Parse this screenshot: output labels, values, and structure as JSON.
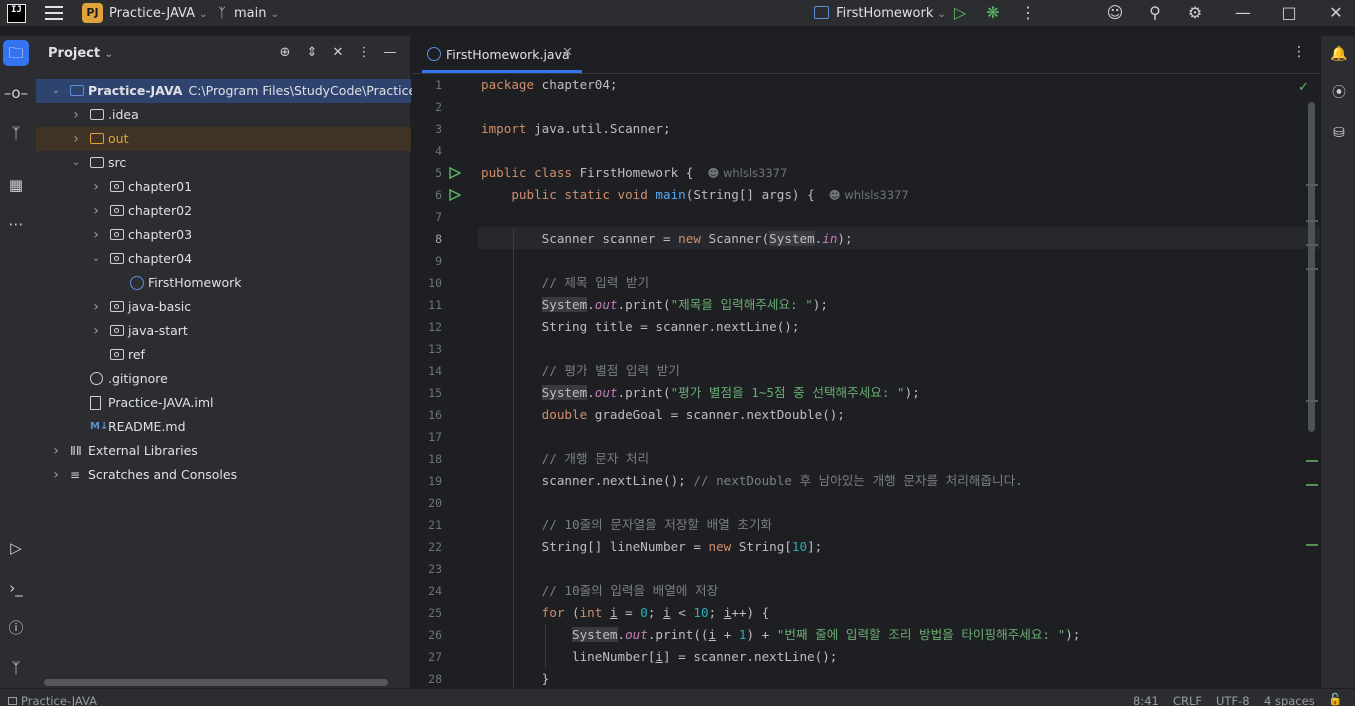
{
  "titlebar": {
    "logo_text": "IJ",
    "project_badge": "PJ",
    "project_name": "Practice-JAVA",
    "branch": "main",
    "run_config": "FirstHomework"
  },
  "project_panel": {
    "title": "Project",
    "tree": [
      {
        "label": "Practice-JAVA",
        "path": "C:\\Program Files\\StudyCode\\Practice-JAV",
        "icon": "folder-icon",
        "depth": 0,
        "expanded": true,
        "selected": true
      },
      {
        "label": ".idea",
        "icon": "folder-icon",
        "depth": 1,
        "expanded": false
      },
      {
        "label": "out",
        "icon": "folder-icon",
        "depth": 1,
        "expanded": false,
        "excluded": true
      },
      {
        "label": "src",
        "icon": "folder-icon",
        "depth": 1,
        "expanded": true
      },
      {
        "label": "chapter01",
        "icon": "package-icon",
        "depth": 2,
        "expanded": false
      },
      {
        "label": "chapter02",
        "icon": "package-icon",
        "depth": 2,
        "expanded": false
      },
      {
        "label": "chapter03",
        "icon": "package-icon",
        "depth": 2,
        "expanded": false
      },
      {
        "label": "chapter04",
        "icon": "package-icon",
        "depth": 2,
        "expanded": true
      },
      {
        "label": "FirstHomework",
        "icon": "class-icon",
        "depth": 3
      },
      {
        "label": "java-basic",
        "icon": "package-icon",
        "depth": 2,
        "expanded": false
      },
      {
        "label": "java-start",
        "icon": "package-icon",
        "depth": 2,
        "expanded": false
      },
      {
        "label": "ref",
        "icon": "package-icon",
        "depth": 2
      },
      {
        "label": ".gitignore",
        "icon": "ignore-icon",
        "depth": 1
      },
      {
        "label": "Practice-JAVA.iml",
        "icon": "file-icon",
        "depth": 1
      },
      {
        "label": "README.md",
        "icon": "markdown-icon",
        "depth": 1
      },
      {
        "label": "External Libraries",
        "icon": "library-icon",
        "depth": 0,
        "expanded": false
      },
      {
        "label": "Scratches and Consoles",
        "icon": "scratch-icon",
        "depth": 0,
        "expanded": false
      }
    ]
  },
  "editor": {
    "tab_label": "FirstHomework.java",
    "author": "whlsls3377",
    "line_numbers": [
      "1",
      "2",
      "3",
      "4",
      "5",
      "6",
      "7",
      "8",
      "9",
      "10",
      "11",
      "12",
      "13",
      "14",
      "15",
      "16",
      "17",
      "18",
      "19",
      "20",
      "21",
      "22",
      "23",
      "24",
      "25",
      "26",
      "27",
      "28"
    ],
    "current_line": "8",
    "code": {
      "l1_kw": "package",
      "l1_rest": " chapter04;",
      "l3_kw": "import",
      "l3_rest": " java.util.Scanner;",
      "l5_kw": "public class",
      "l5_rest": " FirstHomework {",
      "l6_kw": "public static void",
      "l6_fn": "main",
      "l6_rest": "(String[] args) {",
      "l8_a": "Scanner scanner = ",
      "l8_kw": "new",
      "l8_b": " Scanner(",
      "l8_sys": "System",
      "l8_dot": ".",
      "l8_in": "in",
      "l8_c": ");",
      "l10_cm": "// 제목 입력 받기",
      "l11_sys": "System",
      "l11_dot": ".",
      "l11_out": "out",
      "l11_a": ".print(",
      "l11_str": "\"제목을 입력해주세요: \"",
      "l11_b": ");",
      "l12": "String title = scanner.nextLine();",
      "l14_cm": "// 평가 별점 입력 받기",
      "l15_sys": "System",
      "l15_dot": ".",
      "l15_out": "out",
      "l15_a": ".print(",
      "l15_str": "\"평가 별점을 1~5점 중 선택해주세요: \"",
      "l15_b": ");",
      "l16_kw": "double",
      "l16_rest": " gradeGoal = scanner.nextDouble();",
      "l18_cm": "// 개행 문자 처리",
      "l19_a": "scanner.nextLine(); ",
      "l19_cm": "// nextDouble 후 남아있는 개행 문자를 처리해줍니다.",
      "l21_cm": "// 10줄의 문자열을 저장할 배열 초기화",
      "l22_a": "String[] lineNumber = ",
      "l22_kw": "new",
      "l22_b": " String[",
      "l22_num": "10",
      "l22_c": "];",
      "l24_cm": "// 10줄의 입력을 배열에 저장",
      "l25_kw": "for",
      "l25_a": " (",
      "l25_kw2": "int",
      "l25_sp": " ",
      "l25_i1": "i",
      "l25_b": " = ",
      "l25_n0": "0",
      "l25_c": "; ",
      "l25_i2": "i",
      "l25_d": " < ",
      "l25_n10": "10",
      "l25_e": "; ",
      "l25_i3": "i",
      "l25_f": "++) {",
      "l26_sys": "System",
      "l26_dot": ".",
      "l26_out": "out",
      "l26_a": ".print((",
      "l26_i": "i",
      "l26_b": " + ",
      "l26_n1": "1",
      "l26_c": ") + ",
      "l26_str": "\"번째 줄에 입력할 조리 방법을 타이핑해주세요: \"",
      "l26_d": ");",
      "l27_a": "lineNumber[",
      "l27_i": "i",
      "l27_b": "] = scanner.nextLine();",
      "l28": "}"
    }
  },
  "statusbar": {
    "project": "Practice-JAVA",
    "position": "8:41",
    "line_sep": "CRLF",
    "encoding": "UTF-8",
    "indent": "4 spaces"
  },
  "colors": {
    "accent": "#3574f0",
    "keyword": "#cf8e6d",
    "string": "#6aab73",
    "number": "#2aacb8",
    "comment": "#7a7e85",
    "function": "#56a8f5",
    "static_field": "#c77dbb"
  }
}
